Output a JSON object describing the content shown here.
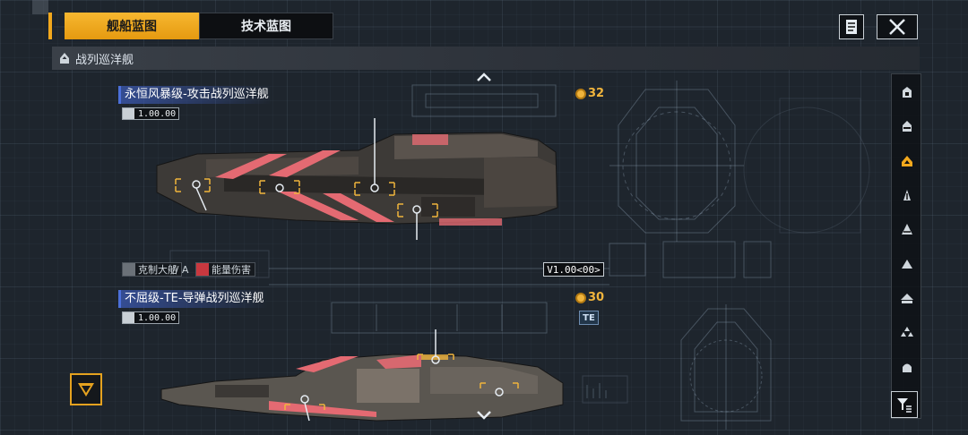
{
  "tabs": [
    {
      "label": "舰船蓝图",
      "active": true
    },
    {
      "label": "技术蓝图",
      "active": false
    }
  ],
  "category": {
    "label": "战列巡洋舰",
    "icon": "battlecruiser-icon"
  },
  "ships": [
    {
      "name": "永恒风暴级-攻击战列巡洋舰",
      "version": "1.00.00",
      "cost": "32",
      "traits": [
        "克制大船",
        "// A",
        "能量伤害"
      ],
      "code": "V1.00<00>"
    },
    {
      "name": "不屈级-TE-导弹战列巡洋舰",
      "version": "1.00.00",
      "cost": "30",
      "tag": "TE"
    }
  ],
  "sidebar_icons": [
    "frigate-icon",
    "destroyer-icon",
    "cruiser-icon",
    "battlecruiser-icon",
    "auxiliary-icon",
    "carrier-icon",
    "battleship-icon",
    "fleet-icon",
    "station-icon"
  ],
  "colors": {
    "accent": "#f2a81d",
    "ship_highlight": "#e46a72",
    "name_bar": "#4b6fd8"
  }
}
